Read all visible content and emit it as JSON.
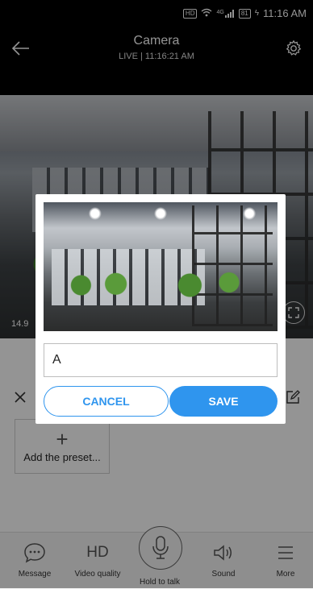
{
  "status_bar": {
    "hd_badge": "HD",
    "signal_text": "4G",
    "battery": "81",
    "time": "11:16 AM"
  },
  "header": {
    "title": "Camera",
    "subtitle": "LIVE | 11:16:21 AM"
  },
  "video": {
    "speed_label": "14.9"
  },
  "preset_panel": {
    "add_preset_label": "Add the preset..."
  },
  "bottom_nav": {
    "items": [
      {
        "label": "Message",
        "icon": "message-icon"
      },
      {
        "label": "Video quality",
        "icon": "hd-icon",
        "icon_text": "HD"
      },
      {
        "label": "Hold to talk",
        "icon": "microphone-icon"
      },
      {
        "label": "Sound",
        "icon": "speaker-icon"
      },
      {
        "label": "More",
        "icon": "menu-icon"
      }
    ]
  },
  "dialog": {
    "input_value": "A",
    "cancel_label": "CANCEL",
    "save_label": "SAVE"
  },
  "colors": {
    "accent": "#2f95ee",
    "header_bg": "#000000",
    "overlay": "rgba(0,0,0,0.42)"
  }
}
